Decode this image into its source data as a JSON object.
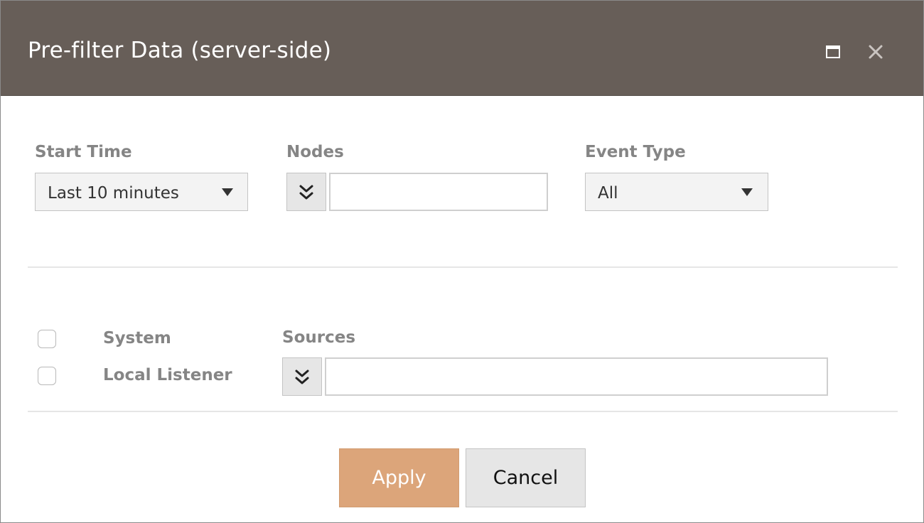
{
  "dialog": {
    "title": "Pre-filter Data (server-side)",
    "maximize_icon": "maximize-icon",
    "close_icon": "close-icon",
    "header_color": "#675e58"
  },
  "filters": {
    "start_time": {
      "label": "Start Time",
      "value": "Last 10 minutes"
    },
    "nodes": {
      "label": "Nodes",
      "value": "",
      "expand_icon": "double-chevron-down-icon"
    },
    "event_type": {
      "label": "Event Type",
      "value": "All"
    }
  },
  "options": {
    "system": {
      "label": "System",
      "checked": false
    },
    "local_listener": {
      "label": "Local Listener",
      "checked": false
    }
  },
  "sources": {
    "label": "Sources",
    "value": "",
    "expand_icon": "double-chevron-down-icon"
  },
  "actions": {
    "apply_label": "Apply",
    "cancel_label": "Cancel",
    "apply_color": "#dca57a"
  }
}
